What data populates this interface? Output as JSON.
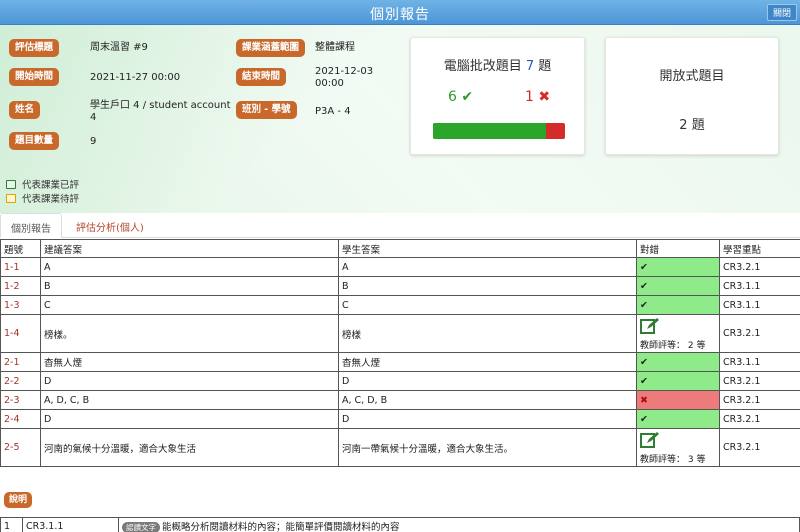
{
  "window": {
    "title": "個別報告",
    "close_label": "關閉"
  },
  "info": {
    "title_label": "評估標題",
    "title_value": "周末溫習 #9",
    "scope_label": "課業涵蓋範圍",
    "scope_value": "整體課程",
    "start_label": "開始時間",
    "start_value": "2021-11-27 00:00",
    "end_label": "結束時間",
    "end_value": "2021-12-03 00:00",
    "name_label": "姓名",
    "name_value": "學生戶口 4 / student account 4",
    "class_label": "班別 - 學號",
    "class_value": "P3A - 4",
    "count_label": "題目數量",
    "count_value": "9"
  },
  "auto_card": {
    "title_prefix": "電腦批改題目",
    "count": "7",
    "title_suffix": "題",
    "right": "6",
    "wrong": "1",
    "right_ratio": 0.857
  },
  "open_card": {
    "title": "開放式題目",
    "count": "2",
    "suffix": "題"
  },
  "legend": {
    "marked": "代表課業已評",
    "pending": "代表課業待評"
  },
  "tabs": [
    "個別報告",
    "評估分析(個人)"
  ],
  "table": {
    "headers": [
      "題號",
      "建議答案",
      "學生答案",
      "對錯",
      "學習重點"
    ],
    "rows": [
      {
        "id": "1-1",
        "suggested": "A",
        "student": "A",
        "result": "✔",
        "key": "CR3.2.1"
      },
      {
        "id": "1-2",
        "suggested": "B",
        "student": "B",
        "result": "✔",
        "key": "CR3.1.1"
      },
      {
        "id": "1-3",
        "suggested": "C",
        "student": "C",
        "result": "✔",
        "key": "CR3.1.1"
      },
      {
        "id": "1-4",
        "suggested": "榜樣。",
        "student": "榜樣",
        "result": "教師評等： 2 等",
        "key": "CR3.2.1"
      },
      {
        "id": "2-1",
        "suggested": "杳無人煙",
        "student": "杳無人煙",
        "result": "✔",
        "key": "CR3.1.1"
      },
      {
        "id": "2-2",
        "suggested": "D",
        "student": "D",
        "result": "✔",
        "key": "CR3.2.1"
      },
      {
        "id": "2-3",
        "suggested": "A, D, C, B",
        "student": "A, C, D, B",
        "result": "✖",
        "key": "CR3.2.1"
      },
      {
        "id": "2-4",
        "suggested": "D",
        "student": "D",
        "result": "✔",
        "key": "CR3.2.1"
      },
      {
        "id": "2-5",
        "suggested": "河南的氣候十分溫暖，適合大象生活",
        "student": "河南一帶氣候十分溫暖，適合大象生活。",
        "result": "教師評等： 3 等",
        "key": "CR3.2.1"
      }
    ]
  },
  "notes": {
    "label": "說明",
    "rows": [
      {
        "no": "1",
        "code": "CR3.1.1",
        "tag": "認讀文字",
        "text": "能概略分析閱讀材料的內容；能簡單評價閱讀材料的內容"
      }
    ]
  },
  "colors": {
    "label_bg": "#c8692b",
    "ok": "#8fea8a",
    "bad": "#ee7b7b",
    "header_blue": "#4d96d6"
  }
}
